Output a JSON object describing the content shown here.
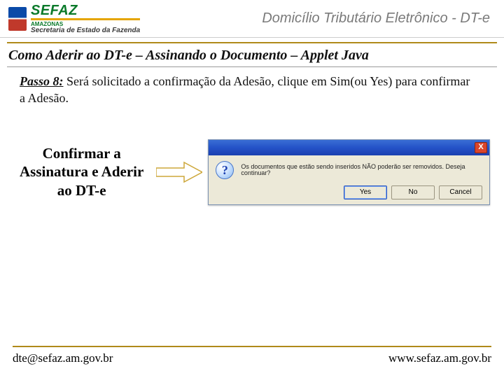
{
  "header": {
    "brand": "SEFAZ",
    "brand_sub": "AMAZONAS",
    "brand_tag": "Secretaria de Estado da Fazenda",
    "product": "Domicílio Tributário Eletrônico - DT-e"
  },
  "section": {
    "title": "Como Aderir ao DT-e – Assinando o Documento – Applet Java"
  },
  "step": {
    "label": "Passo 8:",
    "text": "Será solicitado a confirmação da Adesão, clique em Sim(ou Yes) para confirmar a Adesão."
  },
  "callout": "Confirmar a Assinatura e Aderir ao DT-e",
  "dialog": {
    "close": "X",
    "icon_char": "?",
    "message": "Os documentos que estão sendo inseridos NÃO poderão ser removidos. Deseja continuar?",
    "buttons": {
      "yes": "Yes",
      "no": "No",
      "cancel": "Cancel"
    }
  },
  "footer": {
    "email": "dte@sefaz.am.gov.br",
    "site": "www.sefaz.am.gov.br"
  }
}
